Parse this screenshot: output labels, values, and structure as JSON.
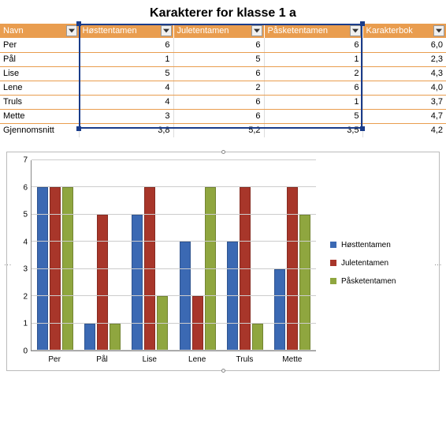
{
  "title": "Karakterer for klasse 1 a",
  "table": {
    "headers": [
      "Navn",
      "Høsttentamen",
      "Juletentamen",
      "Påsketentamen",
      "Karakterbok"
    ],
    "rows": [
      {
        "name": "Per",
        "host": 6,
        "jule": 6,
        "paske": 6,
        "bok": "6,0"
      },
      {
        "name": "Pål",
        "host": 1,
        "jule": 5,
        "paske": 1,
        "bok": "2,3"
      },
      {
        "name": "Lise",
        "host": 5,
        "jule": 6,
        "paske": 2,
        "bok": "4,3"
      },
      {
        "name": "Lene",
        "host": 4,
        "jule": 2,
        "paske": 6,
        "bok": "4,0"
      },
      {
        "name": "Truls",
        "host": 4,
        "jule": 6,
        "paske": 1,
        "bok": "3,7"
      },
      {
        "name": "Mette",
        "host": 3,
        "jule": 6,
        "paske": 5,
        "bok": "4,7"
      }
    ],
    "summary": {
      "label": "Gjennomsnitt",
      "host": "3,8",
      "jule": "5,2",
      "paske": "3,5",
      "bok": "4,2"
    }
  },
  "chart_data": {
    "type": "bar",
    "categories": [
      "Per",
      "Pål",
      "Lise",
      "Lene",
      "Truls",
      "Mette"
    ],
    "series": [
      {
        "name": "Høsttentamen",
        "values": [
          6,
          1,
          5,
          4,
          4,
          3
        ],
        "color": "#3b69b3"
      },
      {
        "name": "Juletentamen",
        "values": [
          6,
          5,
          6,
          2,
          6,
          6
        ],
        "color": "#a8362a"
      },
      {
        "name": "Påsketentamen",
        "values": [
          6,
          1,
          2,
          6,
          1,
          5
        ],
        "color": "#8fa63f"
      }
    ],
    "ylim": [
      0,
      7
    ],
    "yticks": [
      0,
      1,
      2,
      3,
      4,
      5,
      6,
      7
    ],
    "title": "",
    "xlabel": "",
    "ylabel": ""
  }
}
